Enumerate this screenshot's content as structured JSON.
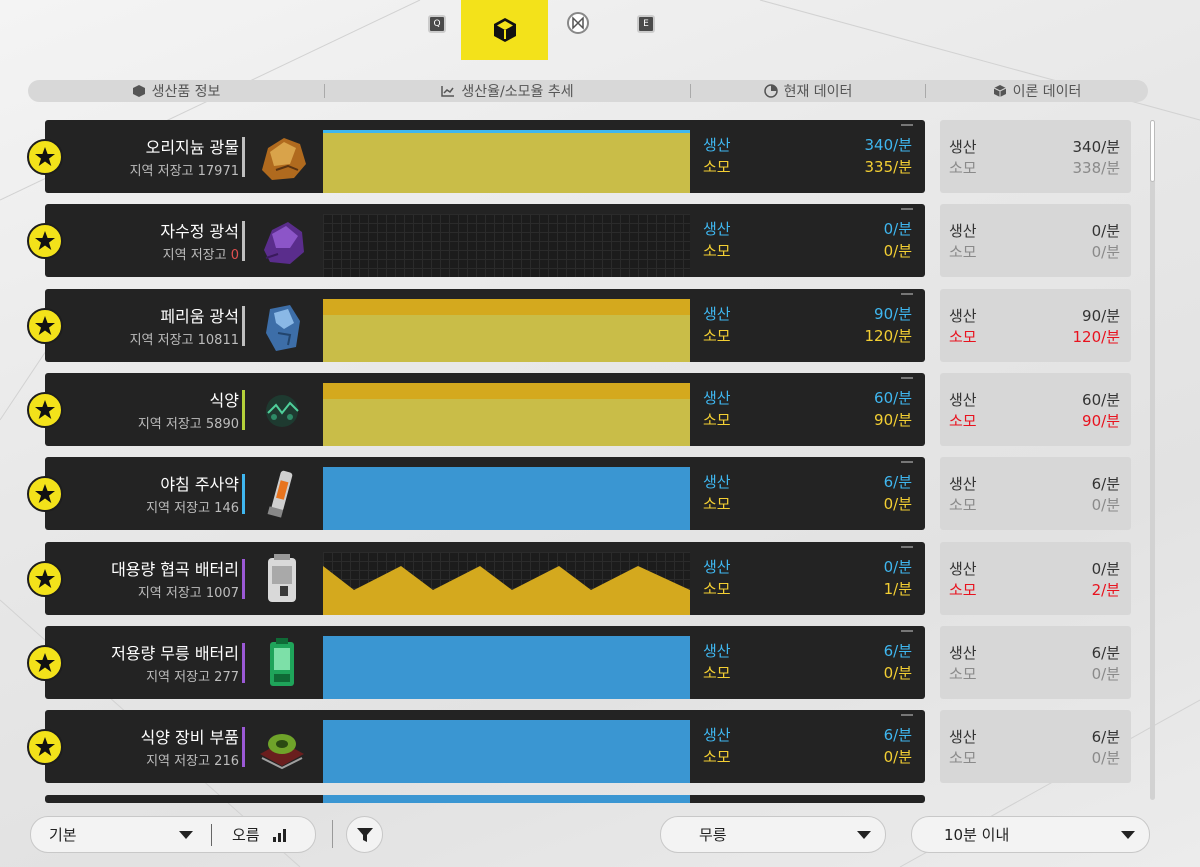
{
  "topbar": {
    "key_left": "Q",
    "key_right": "E",
    "active_tab_icon": "cube-icon",
    "inactive_tab_icon": "network-icon"
  },
  "header": {
    "col1": "생산품 정보",
    "col2": "생산율/소모율 추세",
    "col3": "현재 데이터",
    "col4": "이론 데이터"
  },
  "labels": {
    "prod": "생산",
    "cons": "소모"
  },
  "rows": [
    {
      "name": "오리지늄 광물",
      "store_label": "지역 저장고",
      "store": "17971",
      "prod": "340/분",
      "cons": "335/분",
      "t_prod": "340/분",
      "t_cons": "338/분",
      "t_red": false,
      "accent": "#bfbfbf",
      "chart_kind": "yellow_full",
      "icon": "originium-ore-icon"
    },
    {
      "name": "자수정 광석",
      "store_label": "지역 저장고",
      "store": "0",
      "prod": "0/분",
      "cons": "0/분",
      "t_prod": "0/분",
      "t_cons": "0/분",
      "t_red": false,
      "accent": "#bfbfbf",
      "chart_kind": "empty",
      "icon": "amethyst-ore-icon"
    },
    {
      "name": "페리움 광석",
      "store_label": "지역 저장고",
      "store": "10811",
      "prod": "90/분",
      "cons": "120/분",
      "t_prod": "90/분",
      "t_cons": "120/분",
      "t_red": true,
      "accent": "#bfbfbf",
      "chart_kind": "yellow_two",
      "icon": "ferrium-ore-icon"
    },
    {
      "name": "식양",
      "store_label": "지역 저장고",
      "store": "5890",
      "prod": "60/분",
      "cons": "90/분",
      "t_prod": "60/분",
      "t_cons": "90/분",
      "t_red": true,
      "accent": "#b5d13a",
      "chart_kind": "yellow_two",
      "icon": "plant-icon"
    },
    {
      "name": "야침 주사약",
      "store_label": "지역 저장고",
      "store": "146",
      "prod": "6/분",
      "cons": "0/분",
      "t_prod": "6/분",
      "t_cons": "0/분",
      "t_red": false,
      "accent": "#3fb7f0",
      "chart_kind": "blue",
      "icon": "injector-icon"
    },
    {
      "name": "대용량 협곡 배터리",
      "store_label": "지역 저장고",
      "store": "1007",
      "prod": "0/분",
      "cons": "1/분",
      "t_prod": "0/분",
      "t_cons": "2/분",
      "t_red": true,
      "accent": "#9b59d6",
      "chart_kind": "zigzag",
      "icon": "battery-large-icon"
    },
    {
      "name": "저용량 무릉 배터리",
      "store_label": "지역 저장고",
      "store": "277",
      "prod": "6/분",
      "cons": "0/분",
      "t_prod": "6/분",
      "t_cons": "0/분",
      "t_red": false,
      "accent": "#9b59d6",
      "chart_kind": "blue",
      "icon": "battery-small-icon"
    },
    {
      "name": "식양 장비 부품",
      "store_label": "지역 저장고",
      "store": "216",
      "prod": "6/분",
      "cons": "0/분",
      "t_prod": "6/분",
      "t_cons": "0/분",
      "t_red": false,
      "accent": "#9b59d6",
      "chart_kind": "blue",
      "icon": "equipment-part-icon"
    }
  ],
  "bottom": {
    "sort_value": "기본",
    "order_label": "오름",
    "filter_icon": "filter-icon",
    "region_value": "무릉",
    "time_value": "10분 이내"
  },
  "colors": {
    "accent": "#f3e21a",
    "prod": "#3fb7f0",
    "cons": "#f3cf33",
    "red": "#e8121e"
  }
}
